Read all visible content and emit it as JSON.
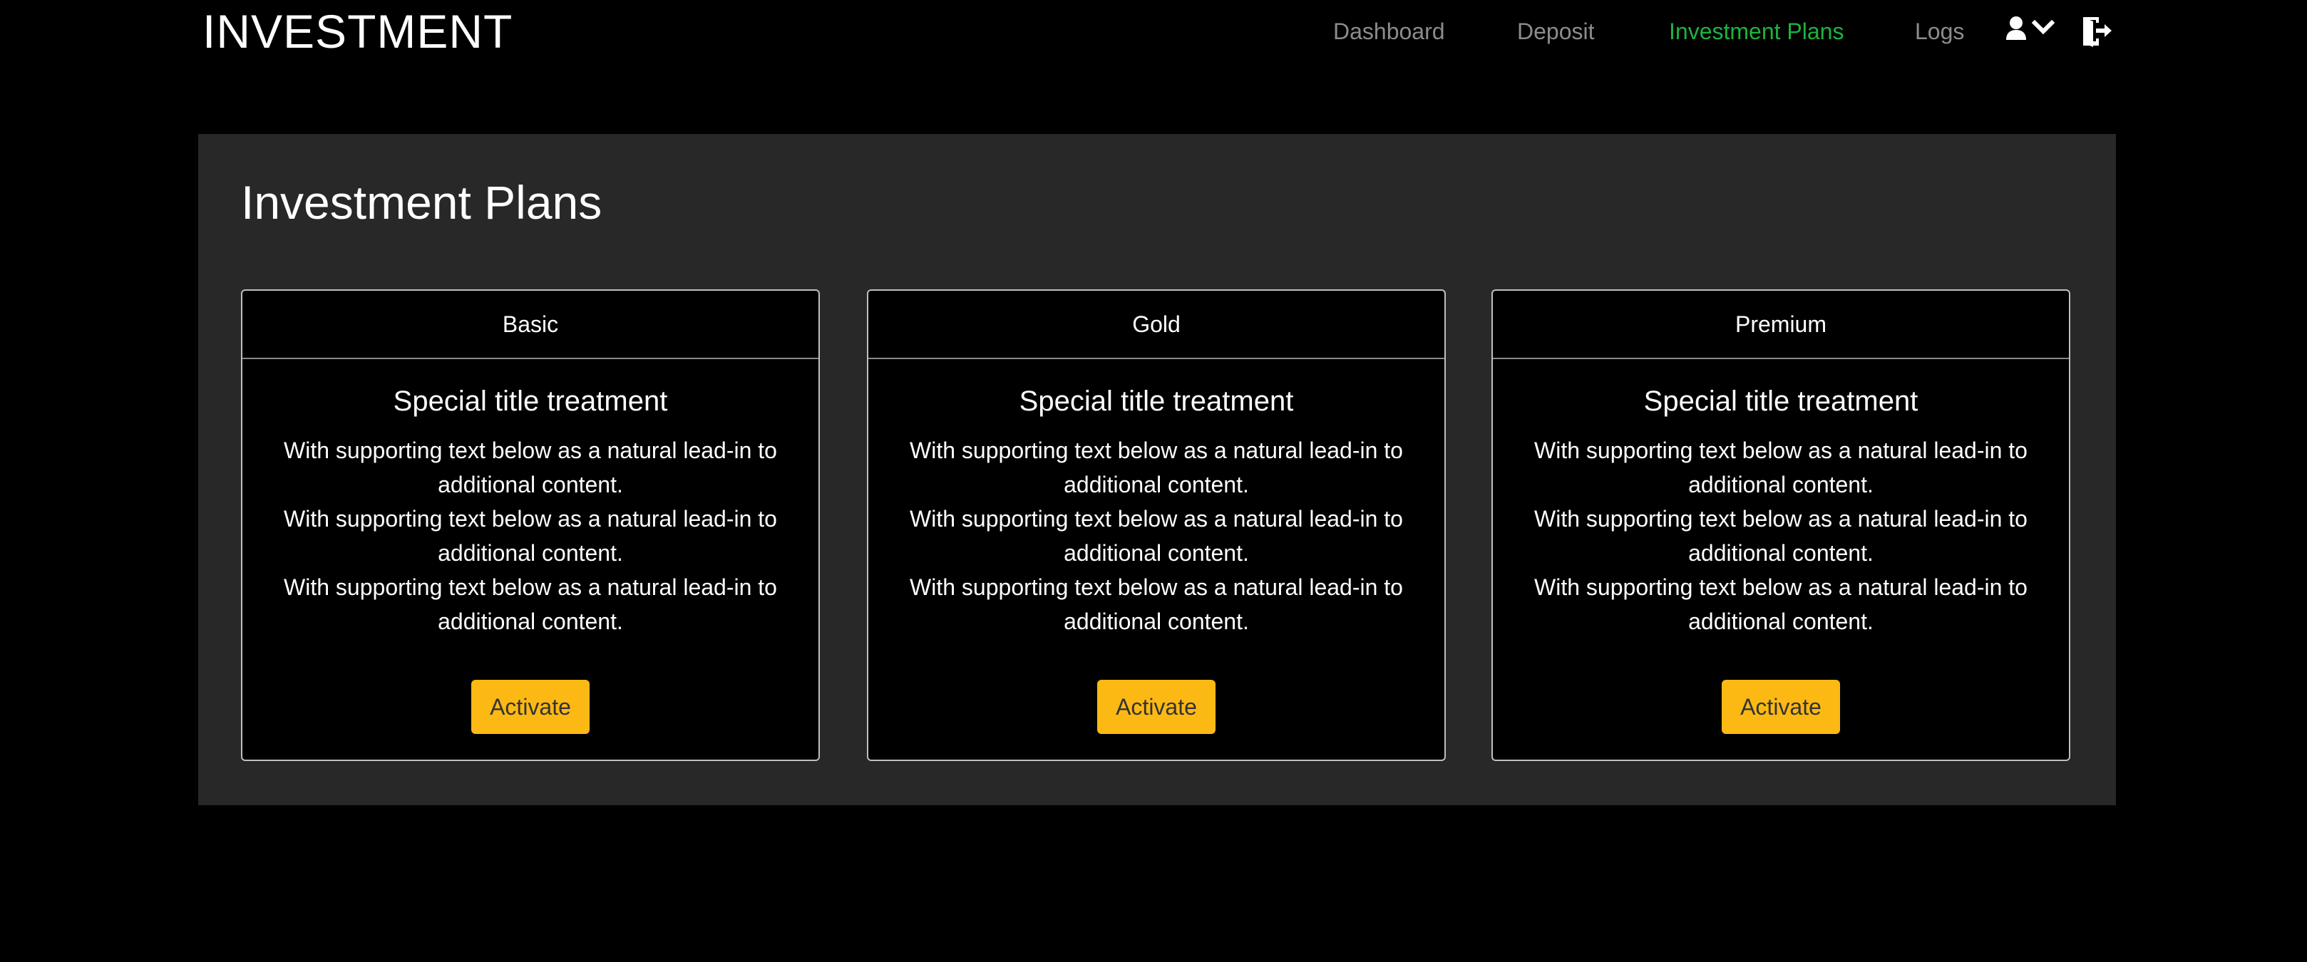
{
  "navbar": {
    "brand": "INVESTMENT",
    "links": [
      {
        "label": "Dashboard"
      },
      {
        "label": "Deposit"
      },
      {
        "label": "Investment Plans"
      },
      {
        "label": "Logs"
      }
    ],
    "icons": [
      "user-icon",
      "chevron-down-icon",
      "logout-icon"
    ],
    "active_color": "#1db33f",
    "link_color": "#8c8c8c"
  },
  "main": {
    "title": "Investment Plans",
    "plans": [
      {
        "name": "Basic",
        "title": "Special title treatment",
        "lines": [
          "With supporting text below as a natural lead-in to additional content.",
          "With supporting text below as a natural lead-in to additional content.",
          "With supporting text below as a natural lead-in to additional content."
        ],
        "button": "Activate"
      },
      {
        "name": "Gold",
        "title": "Special title treatment",
        "lines": [
          "With supporting text below as a natural lead-in to additional content.",
          "With supporting text below as a natural lead-in to additional content.",
          "With supporting text below as a natural lead-in to additional content."
        ],
        "button": "Activate"
      },
      {
        "name": "Premium",
        "title": "Special title treatment",
        "lines": [
          "With supporting text below as a natural lead-in to additional content.",
          "With supporting text below as a natural lead-in to additional content.",
          "With supporting text below as a natural lead-in to additional content."
        ],
        "button": "Activate"
      }
    ],
    "button_color": "#fdb913",
    "panel_color": "#282828"
  }
}
